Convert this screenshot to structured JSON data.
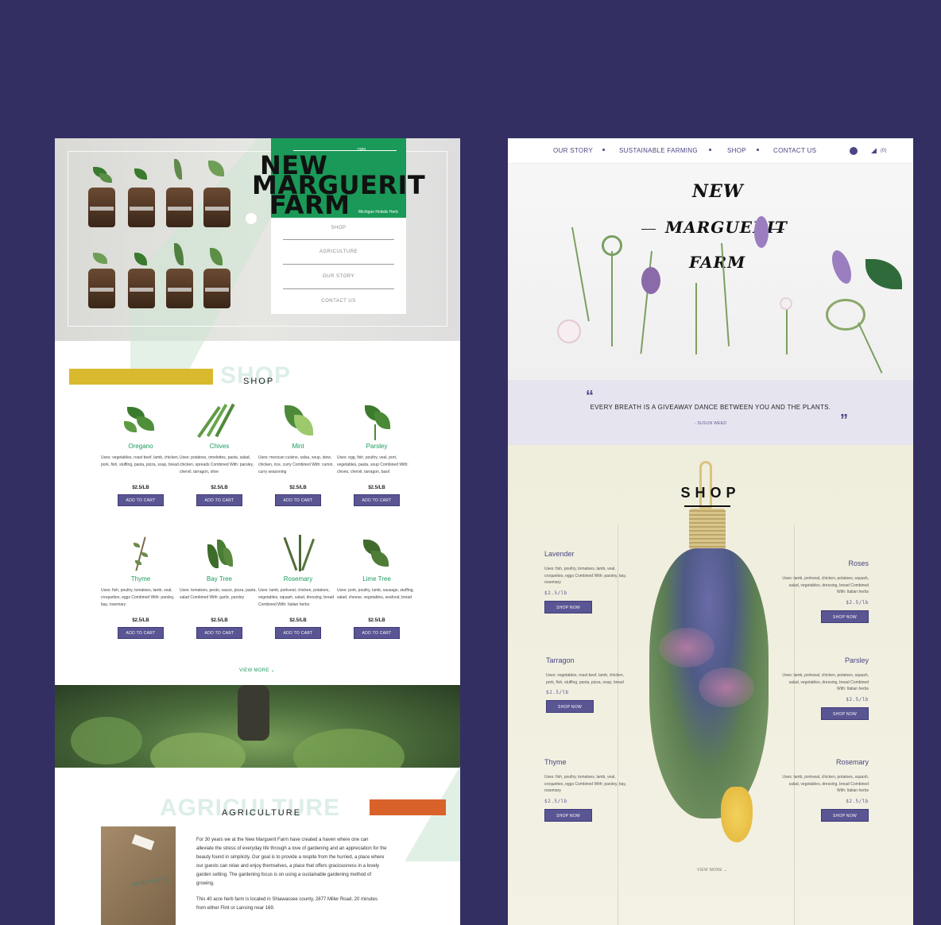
{
  "left": {
    "logo": {
      "year": "1989",
      "title_lines": [
        "NEW",
        "MARGUERIT",
        "FARM"
      ],
      "subtitle": "Michigan Holistic Herb"
    },
    "menu": [
      "SHOP",
      "AGRICULTURE",
      "OUR STORY",
      "CONTACT US"
    ],
    "shop": {
      "ghost": "SHOP",
      "title": "SHOP",
      "accent_color": "#d9b92e",
      "herbs": [
        {
          "name": "Oregano",
          "uses": "Uses: vegetables, roast beef, lamb, chicken, pork, fish, stuffing, pasta, pizza, soup, bread",
          "price": "$2.5/LB",
          "button": "ADD TO CART"
        },
        {
          "name": "Chives",
          "uses": "Uses: potatoes, omelettes, pasta, salad, chicken, spreads Combined With: parsley, chervil, tarragon, olive",
          "price": "$2.5/LB",
          "button": "ADD TO CART"
        },
        {
          "name": "Mint",
          "uses": "Uses: mexican cuisine, salsa, soup, stew, chicken, rice, curry Combined With: cumin, curry seasoning",
          "price": "$2.5/LB",
          "button": "ADD TO CART"
        },
        {
          "name": "Parsley",
          "uses": "Uses: egg, fish, poultry, veal, port, vegetables, pasta, soup Combined With: chives, chervil, tarragon, basil",
          "price": "$2.5/LB",
          "button": "ADD TO CART"
        },
        {
          "name": "Thyme",
          "uses": "Uses: fish, poultry, tomatoes, lamb, veal, croquettes, eggs Combined With: parsley, bay, rosemary",
          "price": "$2.5/LB",
          "button": "ADD TO CART"
        },
        {
          "name": "Bay Tree",
          "uses": "Uses: tomatoes, pesto, sauce, pizza, pasta, salad Combined With: garlic, parsley",
          "price": "$2.5/LB",
          "button": "ADD TO CART"
        },
        {
          "name": "Rosemary",
          "uses": "Uses: lamb, porkveal, chicken, potatoes, vegetables, squash, salad, dressing, bread Combined With: Italian herbs",
          "price": "$2.5/LB",
          "button": "ADD TO CART"
        },
        {
          "name": "Lime Tree",
          "uses": "Uses: pork, poultry, lamb, sausage, stuffing, salad, cheese, vegetables, seafood, bread",
          "price": "$2.5/LB",
          "button": "ADD TO CART"
        }
      ],
      "view_more": "VIEW MORE"
    },
    "agriculture": {
      "ghost": "AGRICULTURE",
      "title": "AGRICULTURE",
      "accent_color": "#d9622b",
      "sack_text": "HERB PHOTO",
      "paragraph1": "For 30 years we at the New Marguerit Farm have created a haven where one can alleviate the stress of everyday life through a love of gardening and an appreciation for the beauty found in simplicity. Our goal is to provide a respite from the hurried, a place where our guests can relax and enjoy themselves, a place that offers graciousness in a lovely garden setting. The gardening focus is on using a sustainable gardening method of growing.",
      "paragraph2": "This 40 acre herb farm is located in Shiawassee county, 2877 Miller Road, 20 minutes from either Flint or Lansing near 169."
    }
  },
  "right": {
    "nav": [
      "OUR STORY",
      "SUSTAINABLE FARMING",
      "SHOP",
      "CONTACT US"
    ],
    "cart_count": "(0)",
    "logo_lines": [
      "NEW",
      "MARGUERIT",
      "FARM"
    ],
    "quote": {
      "text": "EVERY BREATH IS A GIVEAWAY DANCE BETWEEN YOU AND THE PLANTS.",
      "author": "- SUSUN WEED"
    },
    "shop_title": "SHOP",
    "items_left": [
      {
        "name": "Lavender",
        "uses": "Uses: fish, poultry, tomatoes, lamb, veal, croquettes, eggs Combined With: parsley, bay, rosemary",
        "price": "$2.5/lb",
        "button": "SHOP NOW"
      },
      {
        "name": "Tarragon",
        "uses": "Uses: vegetables, roast beef, lamb, chicken, pork, fish, stuffing, pasta, pizza, soup, bread",
        "price": "$2.5/lb",
        "button": "SHOP NOW"
      },
      {
        "name": "Thyme",
        "uses": "Uses: fish, poultry, tomatoes, lamb, veal, croquettes, eggs Combined With: parsley, bay, rosemary",
        "price": "$2.5/lb",
        "button": "SHOP NOW"
      }
    ],
    "items_right": [
      {
        "name": "Roses",
        "uses": "Uses: lamb, porkveal, chicken, potatoes, squash, salad, vegetables, dressing, bread Combined With: Italian herbs",
        "price": "$2.5/lb",
        "button": "SHOP NOW"
      },
      {
        "name": "Parsley",
        "uses": "Uses: lamb, porkveal, chicken, potatoes, squash, salad, vegetables, dressing, bread Combined With: Italian herbs",
        "price": "$2.5/lb",
        "button": "SHOP NOW"
      },
      {
        "name": "Rosemary",
        "uses": "Uses: lamb, porkveal, chicken, potatoes, squash, salad, vegetables, dressing, bread Combined With: Italian herbs",
        "price": "$2.5/lb",
        "button": "SHOP NOW"
      }
    ],
    "view_more": "VIEW MORE"
  },
  "colors": {
    "background": "#332f63",
    "brand_green": "#1a9958",
    "button_purple": "#5a5593"
  }
}
